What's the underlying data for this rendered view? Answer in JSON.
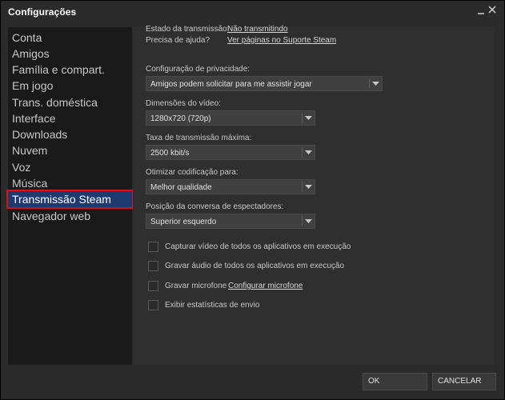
{
  "window": {
    "title": "Configurações"
  },
  "sidebar": {
    "items": [
      {
        "label": "Conta"
      },
      {
        "label": "Amigos"
      },
      {
        "label": "Família e compart."
      },
      {
        "label": "Em jogo"
      },
      {
        "label": "Trans. doméstica"
      },
      {
        "label": "Interface"
      },
      {
        "label": "Downloads"
      },
      {
        "label": "Nuvem"
      },
      {
        "label": "Voz"
      },
      {
        "label": "Música"
      },
      {
        "label": "Transmissão Steam",
        "selected": true
      },
      {
        "label": "Navegador web"
      }
    ]
  },
  "broadcast": {
    "status_label": "Estado da transmissão:",
    "status_value": "Não transmitindo",
    "help_label": "Precisa de ajuda?",
    "help_link": "Ver páginas no Suporte Steam",
    "privacy_label": "Configuração de privacidade:",
    "privacy_value": "Amigos podem solicitar para me assistir jogar",
    "dimensions_label": "Dimensões do vídeo:",
    "dimensions_value": "1280x720 (720p)",
    "bitrate_label": "Taxa de transmissão máxima:",
    "bitrate_value": "2500 kbit/s",
    "encoding_label": "Otimizar codificação para:",
    "encoding_value": "Melhor qualidade",
    "chat_position_label": "Posição da conversa de espectadores:",
    "chat_position_value": "Superior esquerdo",
    "checkboxes": [
      {
        "label": "Capturar vídeo de todos os aplicativos em execução",
        "checked": false
      },
      {
        "label": "Gravar áudio de todos os aplicativos em execução",
        "checked": false
      },
      {
        "label": "Gravar microfone",
        "checked": false
      },
      {
        "label": "Exibir estatísticas de envio",
        "checked": false
      }
    ],
    "configure_mic_link": "Configurar microfone"
  },
  "buttons": {
    "ok": "OK",
    "cancel": "CANCELAR"
  },
  "colors": {
    "window_bg": "#2b2b2b",
    "sidebar_bg": "#1a1a1a",
    "content_bg": "#2f2f2f",
    "selected_bg": "#1e3a6e",
    "highlight_border": "#d3141c"
  },
  "icons": {
    "minimize": "minimize-icon",
    "close": "close-icon",
    "dropdown": "chevron-down-icon"
  }
}
